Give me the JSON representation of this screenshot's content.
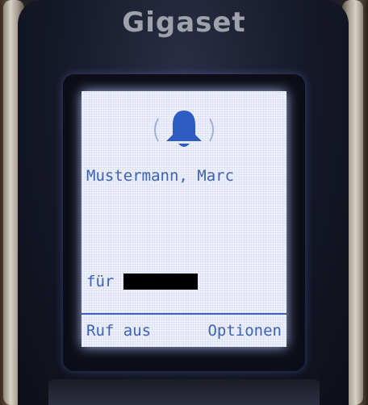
{
  "device": {
    "brand": "Gigaset"
  },
  "incoming_call": {
    "icon": "bell-icon",
    "caller_name": "Mustermann, Marc",
    "for_label": "für",
    "for_value_redacted": true
  },
  "softkeys": {
    "left_label": "Ruf aus",
    "right_label": "Optionen"
  },
  "colors": {
    "display_text": "#3d63b8",
    "display_background": "#eef1fb",
    "brand_text": "#9fa2aa"
  }
}
